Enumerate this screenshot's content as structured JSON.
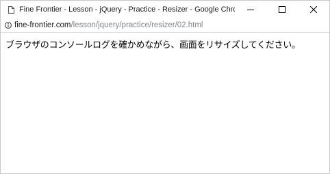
{
  "window": {
    "title": "Fine Frontier - Lesson - jQuery - Practice - Resizer - Google Chrome",
    "icons": {
      "page": "page-icon",
      "minimize": "minimize-icon",
      "maximize": "maximize-icon",
      "close": "close-icon"
    }
  },
  "address_bar": {
    "icon": "info-icon",
    "host": "fine-frontier.com",
    "path": "/lesson/jquery/practice/resizer/02.html"
  },
  "page": {
    "message": "ブラウザのコンソールログを確かめながら、画面をリサイズしてください。"
  },
  "colors": {
    "url_path": "#80868b",
    "text": "#000000"
  }
}
